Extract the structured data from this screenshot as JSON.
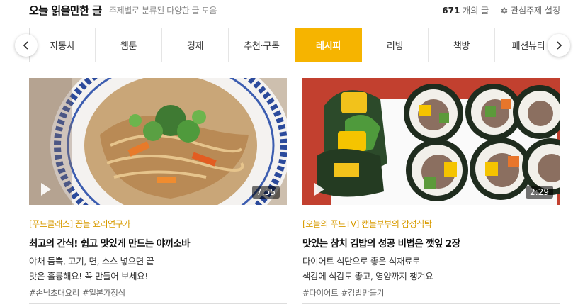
{
  "header": {
    "title": "오늘 읽을만한 글",
    "subtitle": "주제별로 분류된 다양한 글 모음",
    "count": "671",
    "count_suffix": "개의 글",
    "settings_label": "관심주제 설정"
  },
  "tabs": [
    {
      "label": "자동차"
    },
    {
      "label": "웹툰"
    },
    {
      "label": "경제"
    },
    {
      "label": "추천·구독"
    },
    {
      "label": "레시피",
      "active": true
    },
    {
      "label": "리빙"
    },
    {
      "label": "책방"
    },
    {
      "label": "패션뷰티"
    }
  ],
  "cards": [
    {
      "duration": "7:55",
      "source": "[푸드클래스] 꽁블 요리연구가",
      "title": "최고의 간식! 쉽고 맛있게 만드는 야끼소바",
      "desc_line1": "야채 듬뿍, 고기, 면, 소스 넣으면 끝",
      "desc_line2": "맛은 훌륭해요! 꼭 만들어 보세요!",
      "tags": [
        "#손님초대요리",
        "#일본가정식"
      ]
    },
    {
      "duration": "2:29",
      "source": "[오늘의 푸드TV] 캠블부부의 감성식탁",
      "title": "맛있는 참치 김밥의 성공 비법은 깻잎 2장",
      "desc_line1": "다이어트 식단으로 좋은 식재료로",
      "desc_line2": "색감에 식감도 좋고, 영양까지 챙겨요",
      "tags": [
        "#다이어트",
        "#김밥만들기"
      ]
    }
  ],
  "icons": {
    "settings": "gear-icon",
    "prev": "chevron-left-icon",
    "next": "chevron-right-icon",
    "play": "play-icon"
  },
  "colors": {
    "accent": "#f6b400",
    "source_text": "#d89b00"
  }
}
